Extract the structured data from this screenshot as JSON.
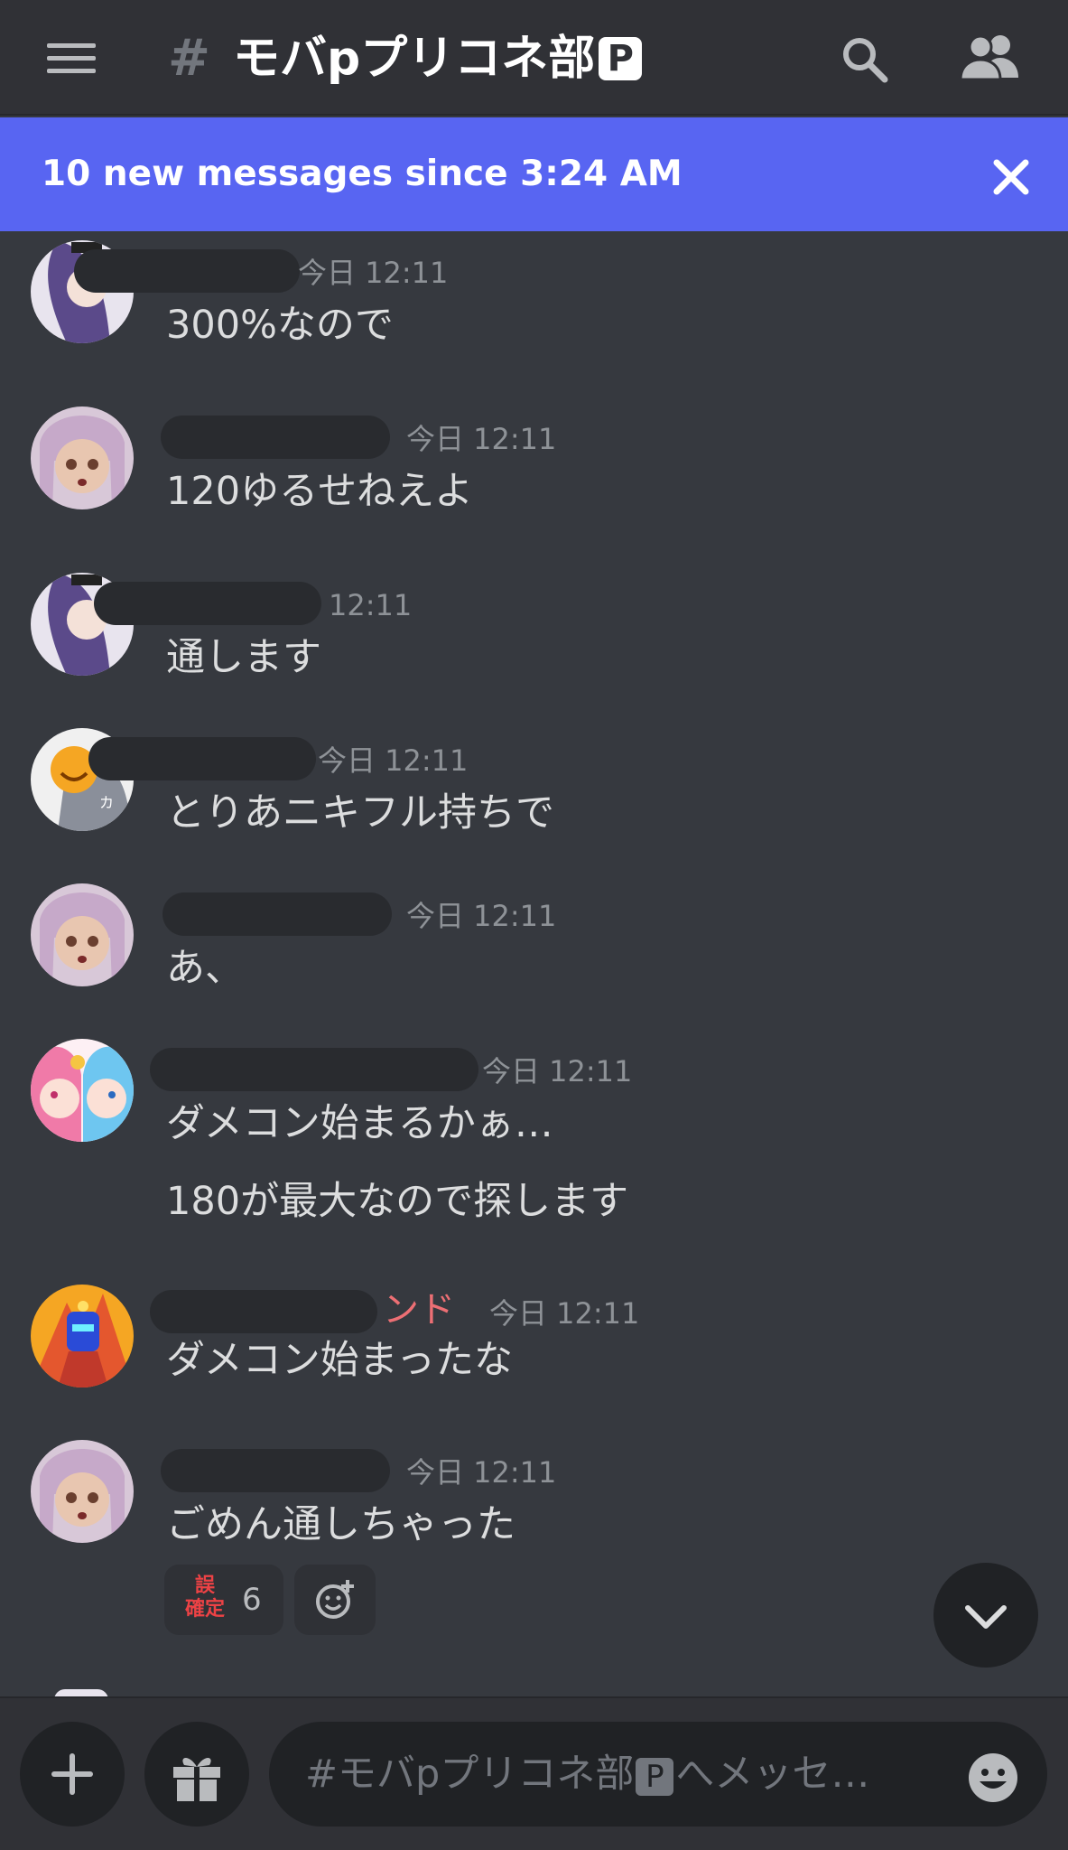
{
  "header": {
    "channel_hash": "#",
    "channel_name": "モバpプリコネ部",
    "channel_badge": "P"
  },
  "banner": {
    "text": "10 new messages since 3:24 AM"
  },
  "messages": [
    {
      "timestamp": "今日 12:11",
      "lines": [
        "300%なので"
      ]
    },
    {
      "timestamp": "今日 12:11",
      "lines": [
        "120ゆるせねえよ"
      ]
    },
    {
      "timestamp": "12:11",
      "lines": [
        "通します"
      ]
    },
    {
      "timestamp": "今日 12:11",
      "lines": [
        "とりあニキフル持ちで"
      ]
    },
    {
      "timestamp": "今日 12:11",
      "lines": [
        "あ、"
      ]
    },
    {
      "timestamp": "今日 12:11",
      "lines": [
        "ダメコン始まるかぁ…",
        "180が最大なので探します"
      ]
    },
    {
      "author_tail": "ンド",
      "timestamp": "今日 12:11",
      "lines": [
        "ダメコン始まったな"
      ]
    },
    {
      "timestamp": "今日 12:11",
      "lines": [
        "ごめん通しちゃった"
      ]
    }
  ],
  "reactions": [
    {
      "emoji_text_top": "誤",
      "emoji_text_bottom": "確定",
      "count": "6"
    }
  ],
  "composer": {
    "placeholder_prefix": "#モバpプリコネ部",
    "placeholder_badge": "P",
    "placeholder_suffix": "へメッセ…"
  },
  "colors": {
    "background": "#36393f",
    "header": "#303136",
    "banner": "#5865f2",
    "timestamp": "#8e9297",
    "author_accent": "#ed6f74"
  }
}
